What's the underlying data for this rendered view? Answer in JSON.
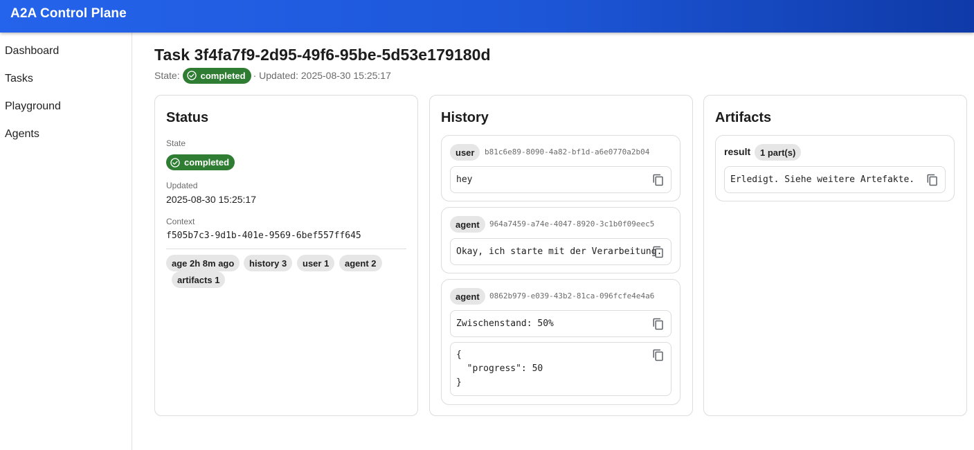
{
  "app": {
    "title": "A2A Control Plane"
  },
  "nav": {
    "items": [
      {
        "label": "Dashboard"
      },
      {
        "label": "Tasks"
      },
      {
        "label": "Playground"
      },
      {
        "label": "Agents"
      }
    ]
  },
  "task": {
    "title": "Task 3f4fa7f9-2d95-49f6-95be-5d53e179180d",
    "state_prefix": "State:",
    "state": "completed",
    "updated_text": "· Updated: 2025-08-30 15:25:17"
  },
  "status_card": {
    "title": "Status",
    "state_label": "State",
    "state_value": "completed",
    "updated_label": "Updated",
    "updated_value": "2025-08-30 15:25:17",
    "context_label": "Context",
    "context_value": "f505b7c3-9d1b-401e-9569-6bef557ff645",
    "stats": [
      "age 2h 8m ago",
      "history 3",
      "user 1",
      "agent 2",
      "artifacts 1"
    ]
  },
  "history_card": {
    "title": "History",
    "messages": [
      {
        "role": "user",
        "id": "b81c6e89-8090-4a82-bf1d-a6e0770a2b04",
        "parts": [
          "hey"
        ]
      },
      {
        "role": "agent",
        "id": "964a7459-a74e-4047-8920-3c1b0f09eec5",
        "parts": [
          "Okay, ich starte mit der Verarbeitung."
        ]
      },
      {
        "role": "agent",
        "id": "0862b979-e039-43b2-81ca-096fcfe4e4a6",
        "parts": [
          "Zwischenstand: 50%",
          "{\n  \"progress\": 50\n}"
        ]
      }
    ]
  },
  "artifacts_card": {
    "title": "Artifacts",
    "artifacts": [
      {
        "name": "result",
        "parts_badge": "1 part(s)",
        "parts": [
          "Erledigt. Siehe weitere Artefakte."
        ]
      }
    ]
  },
  "colors": {
    "appbar": "#2463eb",
    "state_completed": "#2e7d32",
    "pill_bg": "#e6e6e6"
  },
  "icons": {
    "state": "check-circle-icon",
    "copy": "copy-icon"
  }
}
